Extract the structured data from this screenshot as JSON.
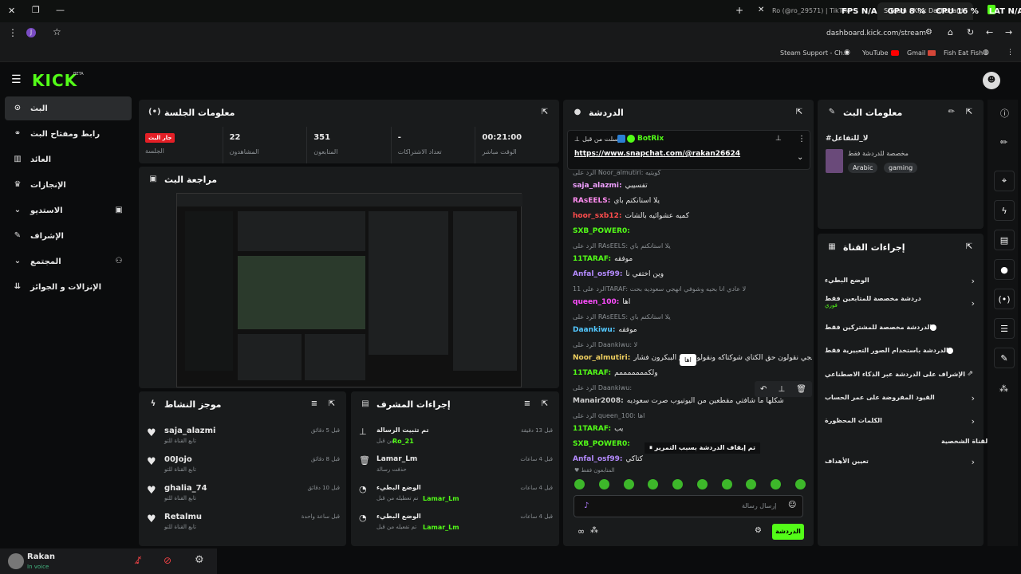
{
  "browser": {
    "tabs": [
      {
        "label": "Ro (@ro_29571) | TikTok"
      },
      {
        "label": "Stream - Kick Dashboard"
      }
    ],
    "overlay": {
      "fps": "FPS N/A",
      "gpu": "GPU 8 %",
      "cpu": "CPU 16 %",
      "lat": "LAT N/A"
    },
    "url": "dashboard.kick.com/stream",
    "bookmarks": [
      "Steam Support - Ch...",
      "YouTube",
      "Gmail",
      "Fish Eat Fish"
    ]
  },
  "header": {
    "logo": "KICK",
    "beta": "BETA"
  },
  "sidebar": {
    "items": [
      {
        "label": "البث",
        "icon": "broadcast-icon"
      },
      {
        "label": "رابط ومفتاح البث",
        "icon": "link-icon"
      },
      {
        "label": "العائد",
        "icon": "chart-icon"
      },
      {
        "label": "الإنجازات",
        "icon": "trophy-icon"
      },
      {
        "label": "الاستديو",
        "icon": "chevron-down-icon"
      },
      {
        "label": "الإشراف",
        "icon": "wrench-icon"
      },
      {
        "label": "المجتمع",
        "icon": "chevron-down-icon"
      },
      {
        "label": "الإنزالات و الجوائز",
        "icon": "drops-icon"
      }
    ],
    "user": {
      "name": "Rakan",
      "status": "In voice"
    }
  },
  "session": {
    "title": "معلومات الجلسة",
    "stats": [
      {
        "label": "الجلسة",
        "value": "جار البث"
      },
      {
        "label": "المشاهدون",
        "value": "22"
      },
      {
        "label": "المتابعون",
        "value": "351"
      },
      {
        "label": "تعداد الاشتراكات",
        "value": "-"
      },
      {
        "label": "الوقت مباشر",
        "value": "00:21:00"
      }
    ]
  },
  "preview": {
    "title": "مراجعة البث"
  },
  "activity": {
    "title": "موجز النشاط",
    "items": [
      {
        "user": "saja_alazmi",
        "action": "تابع القناة للتو",
        "time": "قبل 5 دقائق"
      },
      {
        "user": "00Jojo",
        "action": "تابع القناة للتو",
        "time": "قبل 8 دقائق"
      },
      {
        "user": "ghalia_74",
        "action": "تابع القناة للتو",
        "time": "قبل 10 دقائق"
      },
      {
        "user": "Retalmu",
        "action": "تابع القناة للتو",
        "time": "قبل ساعة واحدة"
      }
    ]
  },
  "modactions": {
    "title": "إجراءات المشرف",
    "items": [
      {
        "title": "تم تثبيت الرسالة",
        "sub": "من قبل",
        "user": "Ro_21",
        "time": "قبل 13 دقيقة"
      },
      {
        "title": "Lamar_Lm",
        "sub": "حذفت رسالة",
        "user": "",
        "time": "قبل 4 ساعات"
      },
      {
        "title": "الوضع البطيء",
        "sub": "تم تعطيله من قبل",
        "user": "Lamar_Lm",
        "time": "قبل 4 ساعات"
      },
      {
        "title": "الوضع البطيء",
        "sub": "تم تفعيله من قبل",
        "user": "Lamar_Lm",
        "time": "قبل 4 ساعات"
      }
    ]
  },
  "chat": {
    "title": "الدردشة",
    "pinned": {
      "by": "أرسلت من قبل",
      "user": "BotRix",
      "link": "https://www.snapchat.com/@rakan26624"
    },
    "lines": [
      {
        "user": "",
        "reply": "الرد على Noor_almutiri: كويتيه",
        "text": ""
      },
      {
        "user": "saja_alazmi:",
        "text": "تفسيبي",
        "color": "#f0a0ff"
      },
      {
        "user": "RAsEELS:",
        "text": "يلا استانكتم باي",
        "color": "#ff8cf0"
      },
      {
        "user": "hoor_sxb12:",
        "text": "كميه عشوائيه بالشات",
        "color": "#ff4d4d"
      },
      {
        "user": "SXB_POWER0:",
        "text": "",
        "color": "#53fc18"
      },
      {
        "user": "",
        "reply": "الرد على RAsEELS: يلا استانكتم باي",
        "text": ""
      },
      {
        "user": "11TARAF:",
        "text": "موفقه",
        "color": "#53fc18"
      },
      {
        "user": "Anfal_osf99:",
        "text": "وين اختفي نا",
        "color": "#b58bff"
      },
      {
        "user": "",
        "reply": "الرد على 11TARAF: لا عادي انا بحيه وشوفي انهجي سعوديه بحت",
        "text": ""
      },
      {
        "user": "queen_100:",
        "text": "اها",
        "color": "#ff4dff"
      },
      {
        "user": "",
        "reply": "الرد على RAsEELS: يلا استانكتم باي",
        "text": ""
      },
      {
        "user": "Daankiwu:",
        "text": "موفقه",
        "color": "#53c8ff"
      },
      {
        "user": "",
        "reply": "الرد على Daankiwu: لا",
        "text": ""
      },
      {
        "user": "Noor_almutiri:",
        "text": "والله من سمجي نقولون حق الكتاي شوكتاكه ونقولون حق الببكرون فشار",
        "color": "#f0d060"
      },
      {
        "user": "11TARAF:",
        "text": "ولكمممممممم",
        "color": "#53fc18"
      },
      {
        "user": "",
        "reply": "الرد على Daankiwu:",
        "text": ""
      },
      {
        "user": "Manair2008:",
        "text": "شكلها ما شافتي مقطعين من اليوتيوب صرت سعوديه",
        "color": "#cfcfcf"
      },
      {
        "user": "",
        "reply": "الرد على queen_100: اها",
        "text": ""
      },
      {
        "user": "11TARAF:",
        "text": "يب",
        "color": "#53fc18"
      },
      {
        "user": "SXB_POWER0:",
        "text": "",
        "color": "#53fc18"
      },
      {
        "user": "Anfal_osf99:",
        "text": "كتاكي",
        "color": "#b58bff"
      }
    ],
    "tooltip": "اها",
    "paused": "تم إيقاف الدردشة بسبب التمرير",
    "followers_only": "المتابعون فقط",
    "input_placeholder": "إرسال رسالة",
    "send": "الدردشة"
  },
  "streaminfo": {
    "title": "معلومات البث",
    "stream_title": "#لا_للتفاعل",
    "sub": "مخصصة للدردشة فقط",
    "tags": [
      "Arabic",
      "gaming"
    ]
  },
  "channel": {
    "title": "إجراءات القناة",
    "items": [
      {
        "label": "الوضع البطيء",
        "control": "chevron"
      },
      {
        "label": "دردشة مخصصة للمتابعين فقط",
        "sub": "فوري",
        "control": "chevron"
      },
      {
        "label": "الدردشة مخصصة للمشتركين فقط",
        "control": "toggle"
      },
      {
        "label": "الدردشة باستخدام الصور التعبيرية فقط",
        "control": "toggle"
      },
      {
        "label": "الإشراف على الدردشة عبر الذكاء الاصطناعي",
        "control": "external"
      },
      {
        "label": "القيود المفروضة على عمر الحساب",
        "control": "chevron"
      },
      {
        "label": "الكلمات المحظورة",
        "control": "chevron"
      }
    ],
    "section": "القناة الشخصية",
    "goals": "تعيين الأهداف"
  }
}
